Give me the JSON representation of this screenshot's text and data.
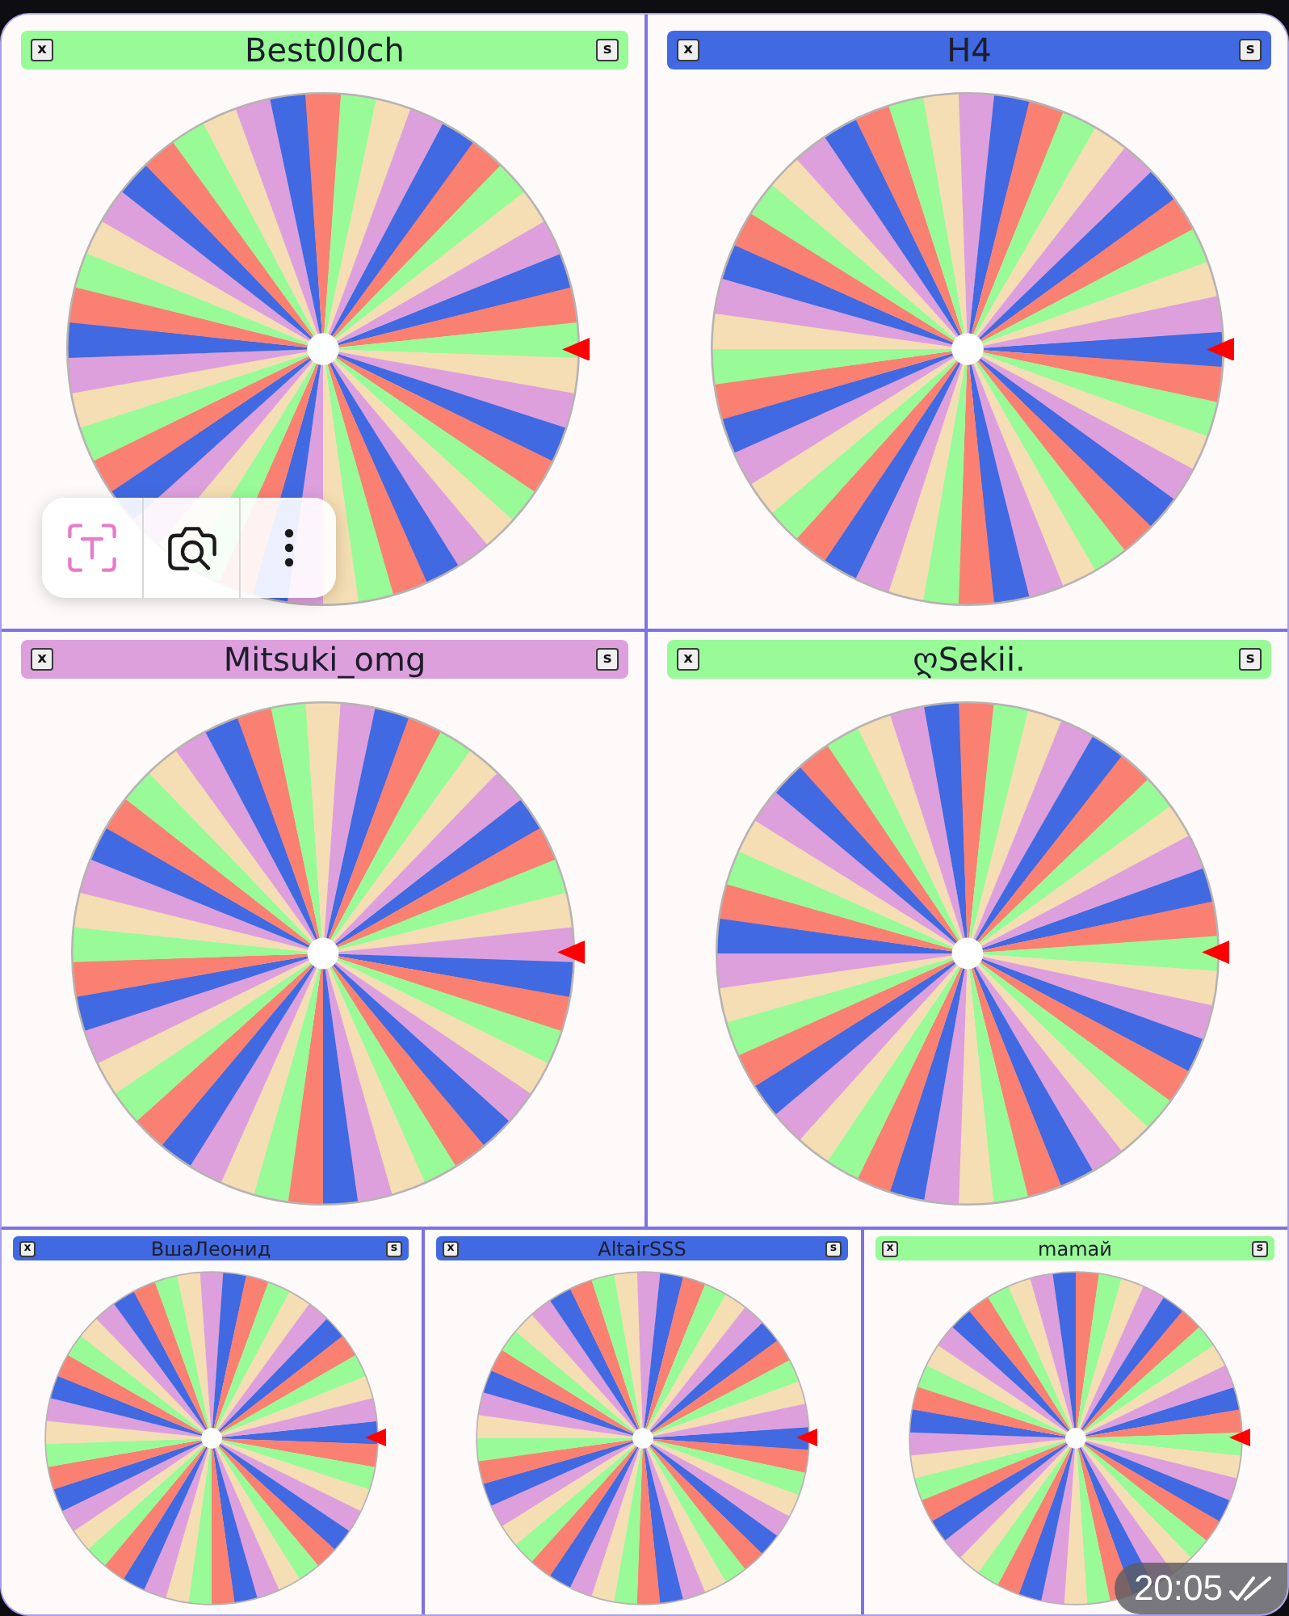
{
  "rows": [
    {
      "panels": [
        {
          "title": "Best0l0ch",
          "color": "#98fb98",
          "left_button": "x",
          "right_button": "s"
        },
        {
          "title": "H4",
          "color": "#4169e1",
          "left_button": "x",
          "right_button": "s"
        }
      ]
    },
    {
      "panels": [
        {
          "title": "Mitsuki_omg",
          "color": "#dda0dd",
          "left_button": "x",
          "right_button": "s"
        },
        {
          "title": "ღSekii.",
          "color": "#98fb98",
          "left_button": "x",
          "right_button": "s"
        }
      ]
    },
    {
      "panels": [
        {
          "title": "ВшаЛеонид",
          "color": "#4169e1",
          "left_button": "x",
          "right_button": "s"
        },
        {
          "title": "AltairSSS",
          "color": "#4169e1",
          "left_button": "x",
          "right_button": "s"
        },
        {
          "title": "mamaй",
          "color": "#98fb98",
          "left_button": "x",
          "right_button": "s"
        }
      ]
    }
  ],
  "message": {
    "time": "20:05",
    "read": true
  }
}
